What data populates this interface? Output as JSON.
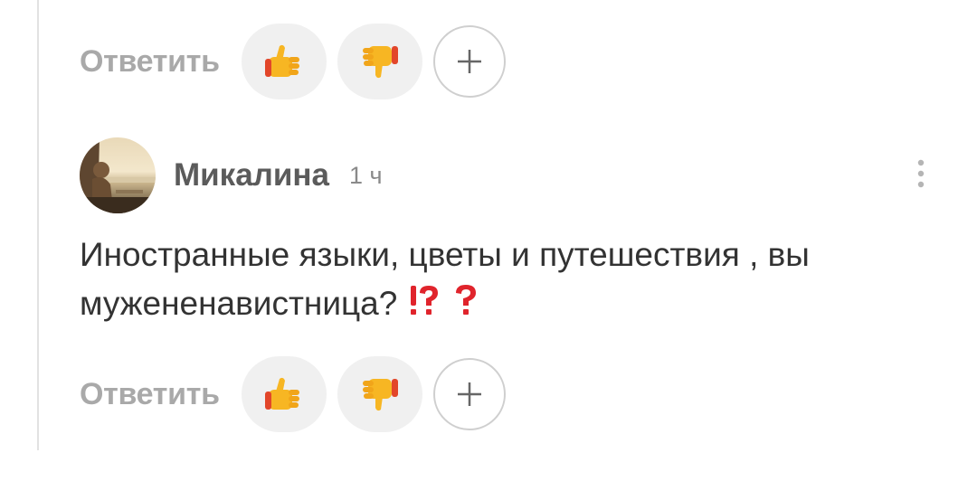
{
  "top_actions": {
    "reply_label": "Ответить",
    "add_reaction_label": "+"
  },
  "comment": {
    "author": "Микалина",
    "time": "1 ч",
    "text": "Иностранные языки, цветы и путешествия , вы мужененавистница?",
    "trailing_emoji": [
      "exclamation-question-icon",
      "red-question-icon"
    ],
    "actions": {
      "reply_label": "Ответить",
      "add_reaction_label": "+"
    }
  },
  "colors": {
    "reply_text": "#a9a9a9",
    "author": "#5b5b5b",
    "body_text": "#333333",
    "emoji_red": "#e0242c",
    "reaction_bg": "#f0f0f0"
  }
}
